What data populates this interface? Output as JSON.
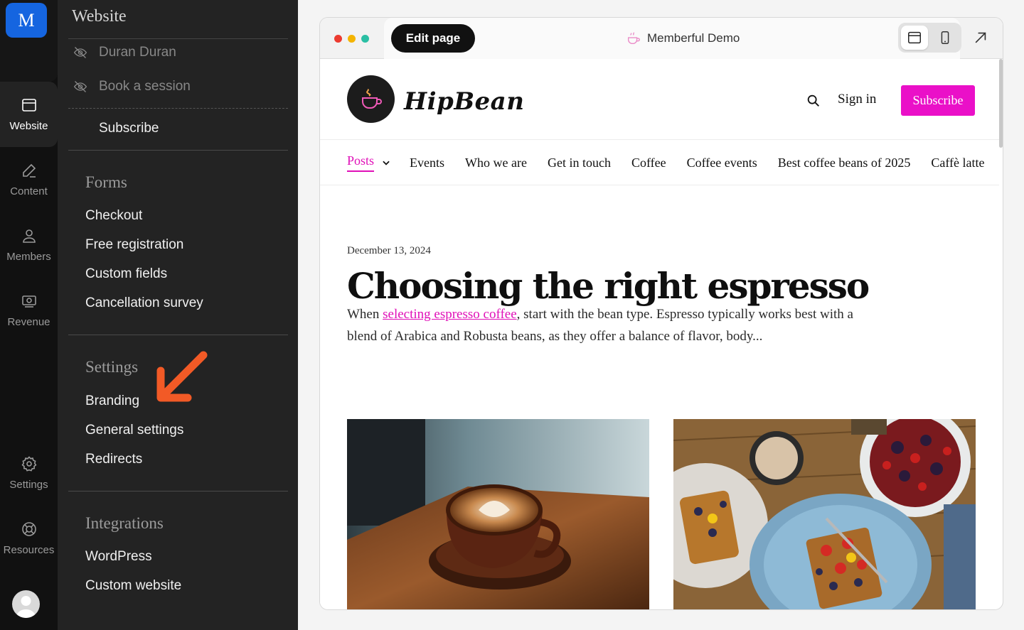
{
  "rail": {
    "logo_letter": "M",
    "items": [
      {
        "label": "Website",
        "icon": "browser-window-icon",
        "active": true
      },
      {
        "label": "Content",
        "icon": "pencil-icon"
      },
      {
        "label": "Members",
        "icon": "person-icon"
      },
      {
        "label": "Revenue",
        "icon": "money-icon"
      },
      {
        "label": "Settings",
        "icon": "gear-icon"
      },
      {
        "label": "Resources",
        "icon": "lifebuoy-icon"
      }
    ]
  },
  "subnav": {
    "title": "Website",
    "hidden_pages": [
      "Duran Duran",
      "Book a session"
    ],
    "subscribe_label": "Subscribe",
    "sections": [
      {
        "heading": "Forms",
        "items": [
          "Checkout",
          "Free registration",
          "Custom fields",
          "Cancellation survey"
        ]
      },
      {
        "heading": "Settings",
        "items": [
          "Branding",
          "General settings",
          "Redirects"
        ]
      },
      {
        "heading": "Integrations",
        "items": [
          "WordPress",
          "Custom website"
        ]
      }
    ]
  },
  "preview": {
    "edit_label": "Edit page",
    "site_title": "Memberful Demo",
    "view_modes": [
      "desktop-view-icon",
      "mobile-view-icon"
    ],
    "open_icon": "external-arrow-icon"
  },
  "site": {
    "brand": "HipBean",
    "signin_label": "Sign in",
    "subscribe_label": "Subscribe",
    "menu": [
      "Posts",
      "Events",
      "Who we are",
      "Get in touch",
      "Coffee",
      "Coffee events",
      "Best coffee beans of 2025",
      "Caffè latte"
    ],
    "post": {
      "date": "December 13, 2024",
      "title": "Choosing the right espresso",
      "excerpt_before": "When ",
      "excerpt_link": "selecting espresso coffee",
      "excerpt_after": ", start with the bean type. Espresso typically works best with a blend of Arabica and Robusta beans, as they offer a balance of flavor, body..."
    }
  },
  "colors": {
    "accent_pink": "#ea10c8",
    "brand_blue": "#1565e0",
    "arrow_orange": "#f25a26"
  }
}
